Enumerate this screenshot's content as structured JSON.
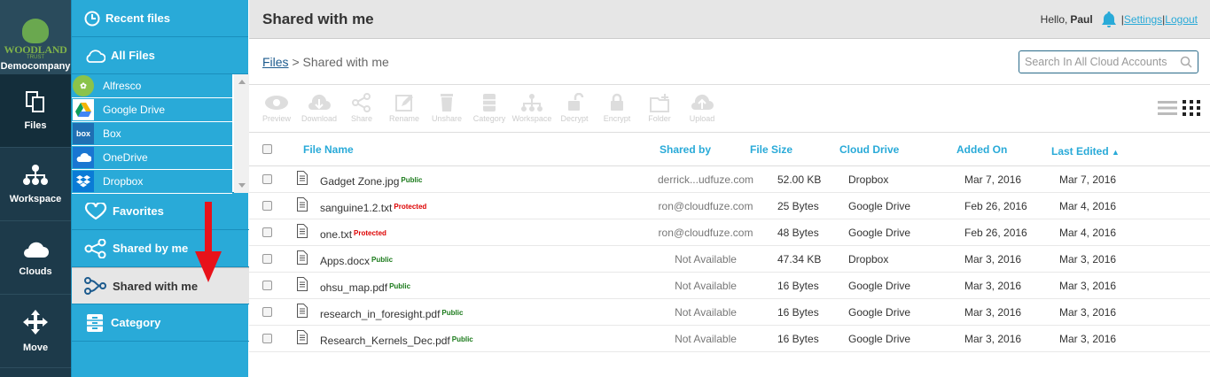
{
  "org": {
    "logo_text": "WOODLAND",
    "logo_sub": "TRUST",
    "company": "Democompany"
  },
  "rail": [
    {
      "label": "Files",
      "icon": "files-icon"
    },
    {
      "label": "Workspace",
      "icon": "workspace-icon"
    },
    {
      "label": "Clouds",
      "icon": "cloud-icon"
    },
    {
      "label": "Move",
      "icon": "move-icon"
    }
  ],
  "nav": {
    "recent": "Recent files",
    "all_files": "All Files",
    "drives": [
      "Alfresco",
      "Google Drive",
      "Box",
      "OneDrive",
      "Dropbox"
    ],
    "favorites": "Favorites",
    "shared_by_me": "Shared by me",
    "shared_with_me": "Shared with me",
    "category": "Category"
  },
  "header": {
    "title": "Shared with me",
    "greeting": "Hello,",
    "user": "Paul",
    "settings": "Settings",
    "logout": "Logout",
    "sep": "|"
  },
  "breadcrumb": {
    "root": "Files",
    "sep": " > ",
    "current": "Shared with me"
  },
  "search": {
    "placeholder": "Search In All Cloud Accounts"
  },
  "toolbar": [
    "Preview",
    "Download",
    "Share",
    "Rename",
    "Unshare",
    "Category",
    "Workspace",
    "Decrypt",
    "Encrypt",
    "Folder",
    "Upload"
  ],
  "table": {
    "headers": {
      "name": "File Name",
      "shared_by": "Shared by",
      "size": "File Size",
      "drive": "Cloud Drive",
      "added": "Added On",
      "edited": "Last Edited",
      "sort_arrow": "▲"
    },
    "rows": [
      {
        "name": "Gadget Zone.jpg",
        "tag": "Public",
        "shared_by": "derrick...udfuze.com",
        "size": "52.00 KB",
        "drive": "Dropbox",
        "added": "Mar 7, 2016",
        "edited": "Mar 7, 2016"
      },
      {
        "name": "sanguine1.2.txt",
        "tag": "Protected",
        "shared_by": "ron@cloudfuze.com",
        "size": "25 Bytes",
        "drive": "Google Drive",
        "added": "Feb 26, 2016",
        "edited": "Mar 4, 2016"
      },
      {
        "name": "one.txt",
        "tag": "Protected",
        "shared_by": "ron@cloudfuze.com",
        "size": "48 Bytes",
        "drive": "Google Drive",
        "added": "Feb 26, 2016",
        "edited": "Mar 4, 2016"
      },
      {
        "name": "Apps.docx",
        "tag": "Public",
        "shared_by": "Not Available",
        "size": "47.34 KB",
        "drive": "Dropbox",
        "added": "Mar 3, 2016",
        "edited": "Mar 3, 2016"
      },
      {
        "name": "ohsu_map.pdf",
        "tag": "Public",
        "shared_by": "Not Available",
        "size": "16 Bytes",
        "drive": "Google Drive",
        "added": "Mar 3, 2016",
        "edited": "Mar 3, 2016"
      },
      {
        "name": "research_in_foresight.pdf",
        "tag": "Public",
        "shared_by": "Not Available",
        "size": "16 Bytes",
        "drive": "Google Drive",
        "added": "Mar 3, 2016",
        "edited": "Mar 3, 2016"
      },
      {
        "name": "Research_Kernels_Dec.pdf",
        "tag": "Public",
        "shared_by": "Not Available",
        "size": "16 Bytes",
        "drive": "Google Drive",
        "added": "Mar 3, 2016",
        "edited": "Mar 3, 2016"
      }
    ]
  },
  "colors": {
    "nav_blue": "#29aad8",
    "rail": "#1d3a4a",
    "public": "#1a7a1a",
    "protected": "#dd0000",
    "arrow": "#e8121a"
  }
}
